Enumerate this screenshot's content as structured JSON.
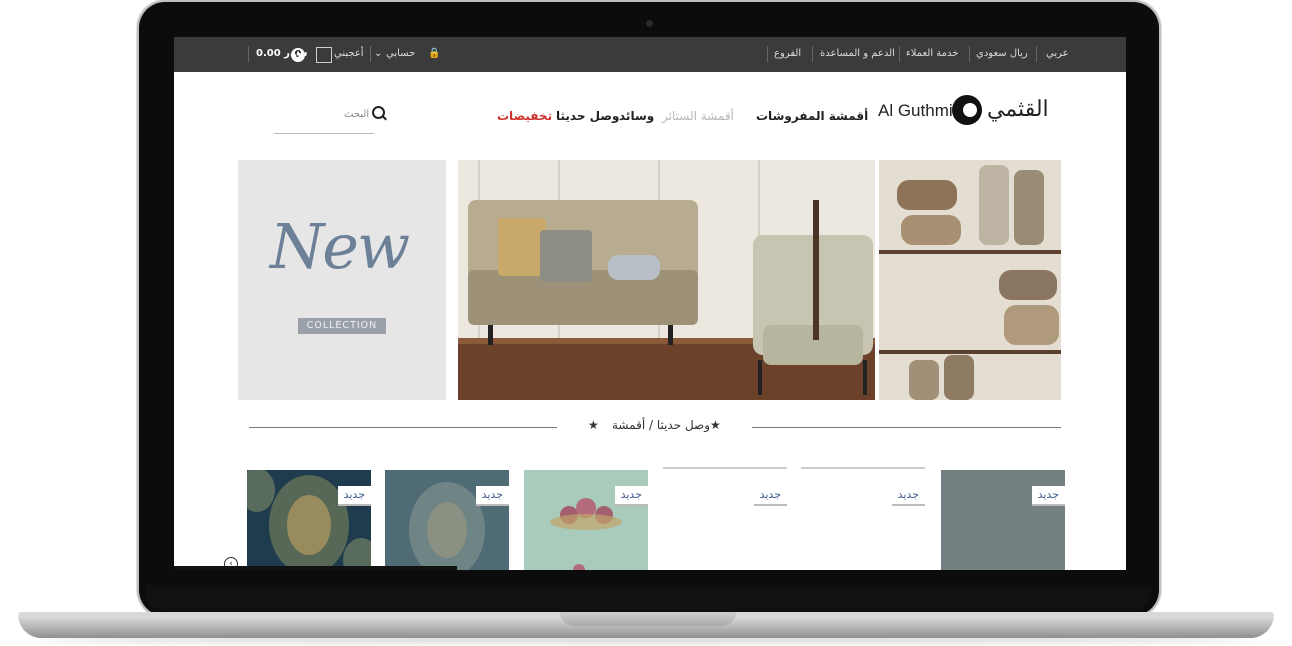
{
  "topbar": {
    "language": "عربي",
    "currency": "ريال سعودي",
    "customer_service": "خدمة العملاء",
    "support": "الدعم و المساعدة",
    "branches": "الفروع",
    "account": "حسابي",
    "wishlist": "أعجبني",
    "cart_total": "0.00 س.ر",
    "cart_count": "0"
  },
  "header": {
    "logo_ar": "القثمي",
    "logo_en": "Al Guthmi",
    "nav": [
      {
        "label": "أقمشة المفروشات",
        "color": "#222222"
      },
      {
        "label": "أقمشة الستائر",
        "color": "#b8b8b8"
      },
      {
        "label": "وسائد",
        "color": "#222222"
      },
      {
        "label": "وصل حديثا",
        "color": "#222222"
      },
      {
        "label": "تخفيضات",
        "color": "#d0312d"
      }
    ],
    "search_placeholder": "البحث"
  },
  "banners": {
    "new_title": "New",
    "new_subtitle": "COLLECTION"
  },
  "section": {
    "title": "وصل حديثا / أقمشة",
    "star_icon": "star-icon"
  },
  "products": [
    {
      "badge": "جديد",
      "swatch": "navy-damask"
    },
    {
      "badge": "جديد",
      "swatch": "blue-paisley"
    },
    {
      "badge": "جديد",
      "swatch": "mint-floral"
    },
    {
      "badge": "جديد",
      "swatch": "blank"
    },
    {
      "badge": "جديد",
      "swatch": "blank"
    },
    {
      "badge": "جديد",
      "swatch": "blue-linen"
    }
  ]
}
